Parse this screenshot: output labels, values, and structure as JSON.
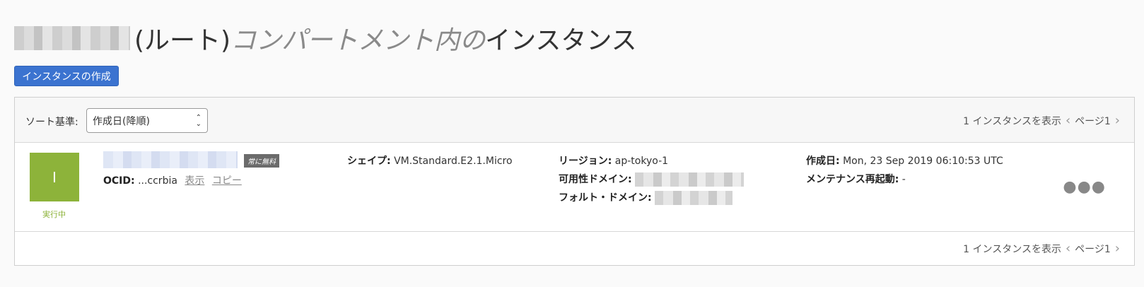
{
  "title": {
    "paren": "(ルート)",
    "middle": "コンパートメント内の",
    "end": "インスタンス"
  },
  "create_button": "インスタンスの作成",
  "toolbar": {
    "sort_label": "ソート基準:",
    "sort_value": "作成日(降順)",
    "pager_text": "1 インスタンスを表示",
    "page_label": "ページ1"
  },
  "instance": {
    "state_letter": "I",
    "state_label": "実行中",
    "badge": "常に無料",
    "ocid_label": "OCID:",
    "ocid_value": "...ccrbia",
    "show_link": "表示",
    "copy_link": "コピー",
    "shape_label": "シェイプ:",
    "shape_value": "VM.Standard.E2.1.Micro",
    "region_label": "リージョン:",
    "region_value": "ap-tokyo-1",
    "ad_label": "可用性ドメイン:",
    "fd_label": "フォルト・ドメイン:",
    "created_label": "作成日:",
    "created_value": "Mon, 23 Sep 2019 06:10:53 UTC",
    "maint_label": "メンテナンス再起動:",
    "maint_value": "-"
  },
  "footer": {
    "pager_text": "1 インスタンスを表示",
    "page_label": "ページ1"
  },
  "colors": {
    "accent": "#3b73d0",
    "running": "#8db33a"
  },
  "icons": {
    "prev": "chevron-left-icon",
    "next": "chevron-right-icon",
    "menu": "more-options-icon",
    "select": "select-caret-icon"
  }
}
